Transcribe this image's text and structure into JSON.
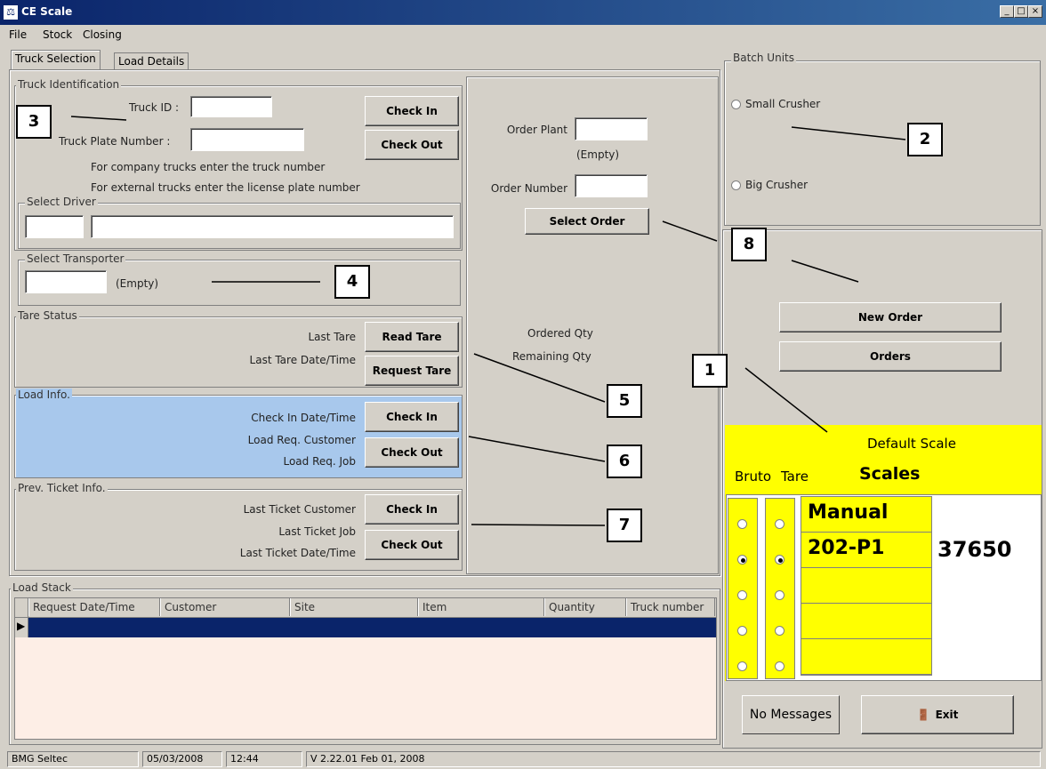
{
  "window": {
    "title": "CE Scale",
    "icon": "scale-icon"
  },
  "menu": [
    "File",
    "Stock",
    "Closing"
  ],
  "tabs": [
    {
      "label": "Truck Selection",
      "active": true
    },
    {
      "label": "Load Details",
      "active": false
    }
  ],
  "truck_identification": {
    "group_label": "Truck Identification",
    "truck_id_label": "Truck ID :",
    "truck_plate_label": "Truck Plate Number   :",
    "hint1": "For company trucks enter the truck number",
    "hint2": "For external trucks enter the license plate number",
    "check_in": "Check In",
    "check_out": "Check Out"
  },
  "select_driver": {
    "group_label": "Select Driver"
  },
  "select_transporter": {
    "group_label": "Select Transporter",
    "value_text": "(Empty)"
  },
  "tare_status": {
    "group_label": "Tare Status",
    "last_tare": "Last Tare",
    "last_tare_datetime": "Last Tare Date/Time",
    "read_tare": "Read Tare",
    "request_tare": "Request Tare"
  },
  "load_info": {
    "group_label": "Load Info.",
    "check_in_datetime": "Check In Date/Time",
    "load_req_customer": "Load Req. Customer",
    "load_req_job": "Load Req. Job",
    "check_in": "Check In",
    "check_out": "Check Out"
  },
  "prev_ticket": {
    "group_label": "Prev. Ticket Info.",
    "last_ticket_customer": "Last Ticket Customer",
    "last_ticket_job": "Last Ticket Job",
    "last_ticket_datetime": "Last Ticket Date/Time",
    "check_in": "Check In",
    "check_out": "Check Out"
  },
  "order": {
    "order_plant_label": "Order Plant",
    "order_plant_value": "(Empty)",
    "order_number_label": "Order Number",
    "select_order": "Select Order",
    "ordered_qty": "Ordered Qty",
    "remaining_qty": "Remaining Qty"
  },
  "batch_units": {
    "group_label": "Batch Units",
    "small_crusher": "Small Crusher",
    "big_crusher": "Big Crusher"
  },
  "order_buttons": {
    "new_order": "New Order",
    "orders": "Orders"
  },
  "scale_panel": {
    "default_scale": "Default Scale",
    "bruto": "Bruto",
    "tare": "Tare",
    "scales": "Scales",
    "rows": [
      {
        "name": "Manual",
        "value": "",
        "bruto_on": false,
        "tare_on": false
      },
      {
        "name": "202-P1",
        "value": "37650",
        "bruto_on": true,
        "tare_on": true
      },
      {
        "name": "",
        "value": "",
        "bruto_on": false,
        "tare_on": false
      },
      {
        "name": "",
        "value": "",
        "bruto_on": false,
        "tare_on": false
      },
      {
        "name": "",
        "value": "",
        "bruto_on": false,
        "tare_on": false
      }
    ]
  },
  "messages": {
    "label": "No Messages"
  },
  "exit": {
    "label": "Exit",
    "icon": "exit-door-icon"
  },
  "load_stack": {
    "group_label": "Load Stack",
    "columns": [
      "Request Date/Time",
      "Customer",
      "Site",
      "Item",
      "Quantity",
      "Truck number"
    ]
  },
  "callouts": [
    "1",
    "2",
    "3",
    "4",
    "5",
    "6",
    "7",
    "8"
  ],
  "status_bar": [
    "BMG Seltec",
    "05/03/2008",
    "12:44",
    "V 2.22.01 Feb 01, 2008"
  ]
}
